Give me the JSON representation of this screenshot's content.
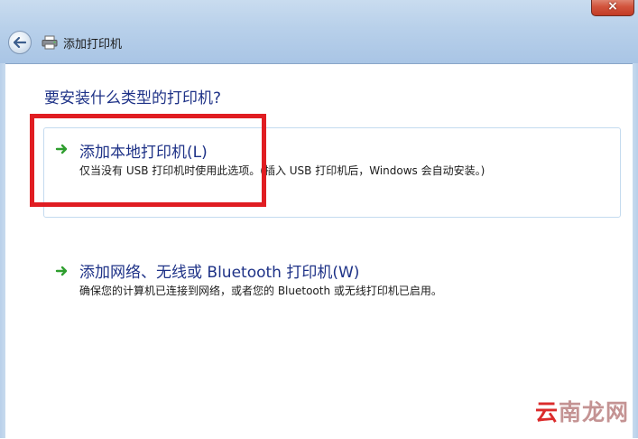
{
  "window": {
    "title": "添加打印机",
    "close_glyph": "×"
  },
  "icons": {
    "back": "back-arrow-icon",
    "printer": "printer-icon",
    "option_arrow": "green-arrow-icon"
  },
  "main": {
    "heading": "要安装什么类型的打印机?"
  },
  "options": [
    {
      "title": "添加本地打印机(L)",
      "description": "仅当没有 USB 打印机时使用此选项。(插入 USB 打印机后，Windows 会自动安装。)"
    },
    {
      "title": "添加网络、无线或 Bluetooth 打印机(W)",
      "description": "确保您的计算机已连接到网络，或者您的 Bluetooth 或无线打印机已启用。"
    }
  ],
  "watermark": {
    "lead": "云",
    "rest": "南龙网"
  },
  "colors": {
    "accent_text": "#1e3287",
    "frame": "#b8d0ea",
    "highlight_border": "#e01d22",
    "option_border": "#c4dbef",
    "arrow_green": "#2e9e2e",
    "watermark": "#d81a1a"
  }
}
